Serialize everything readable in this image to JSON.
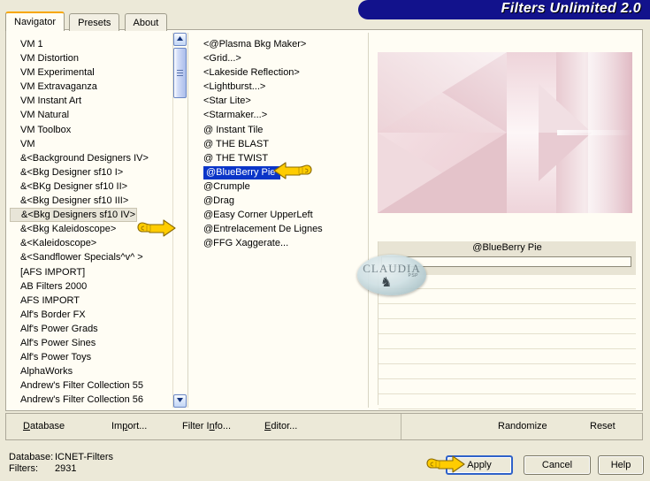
{
  "window": {
    "title": "Filters Unlimited 2.0",
    "banner_color": "#12128c",
    "banner_text_color": "#ffffff"
  },
  "tabs": [
    {
      "label": "Navigator",
      "active": true
    },
    {
      "label": "Presets",
      "active": false
    },
    {
      "label": "About",
      "active": false
    }
  ],
  "navigator_list": {
    "items": [
      "VM 1",
      "VM Distortion",
      "VM Experimental",
      "VM Extravaganza",
      "VM Instant Art",
      "VM Natural",
      "VM Toolbox",
      "VM",
      "&<Background Designers IV>",
      "&<Bkg Designer sf10 I>",
      "&<BKg Designer sf10 II>",
      "&<Bkg Designer sf10 III>",
      "&<Bkg Designers sf10 IV>",
      "&<Bkg Kaleidoscope>",
      "&<Kaleidoscope>",
      "&<Sandflower Specials^v^ >",
      "[AFS IMPORT]",
      "AB Filters 2000",
      "AFS IMPORT",
      "Alf's Border FX",
      "Alf's Power Grads",
      "Alf's Power Sines",
      "Alf's Power Toys",
      "AlphaWorks",
      "Andrew's Filter Collection 55",
      "Andrew's Filter Collection 56"
    ],
    "selected_index": 12,
    "selected_bg": "#e8e5d8"
  },
  "filter_list": {
    "items": [
      "<@Plasma Bkg Maker>",
      "<Grid...>",
      "<Lakeside Reflection>",
      "<Lightburst...>",
      "<Star Lite>",
      "<Starmaker...>",
      "@ Instant Tile",
      "@ THE BLAST",
      "@ THE TWIST",
      "@BlueBerry Pie",
      "@Crumple",
      "@Drag",
      "@Easy Corner UpperLeft",
      "@Entrelacement De Lignes",
      "@FFG Xaggerate..."
    ],
    "selected_index": 9,
    "selected_bg": "#0a35c8",
    "selected_fg": "#ffffff"
  },
  "preview": {
    "selected_filter_name": "@BlueBerry Pie",
    "base_color": "#eed2d6",
    "accent_color": "#d8a6b0"
  },
  "watermark": {
    "text": "CLAUDIA",
    "subtext": "PSP",
    "deco": "♞"
  },
  "toolbar": {
    "database_label": "Database",
    "import_label": "Import...",
    "filter_info_label": "Filter Info...",
    "editor_label": "Editor...",
    "randomize_label": "Randomize",
    "reset_label": "Reset"
  },
  "status": {
    "database_label": "Database:",
    "database_value": "ICNET-Filters",
    "filters_label": "Filters:",
    "filters_value": "2931"
  },
  "dialog_buttons": {
    "apply_label": "Apply",
    "cancel_label": "Cancel",
    "help_label": "Help"
  },
  "cursors": {
    "nav_pointer": "pointing-hand-icon",
    "filter_pointer": "pointing-hand-icon",
    "apply_pointer": "pointing-hand-icon"
  },
  "scrollbars": {
    "up_arrow": "scroll-up-icon",
    "down_arrow": "scroll-down-icon"
  }
}
